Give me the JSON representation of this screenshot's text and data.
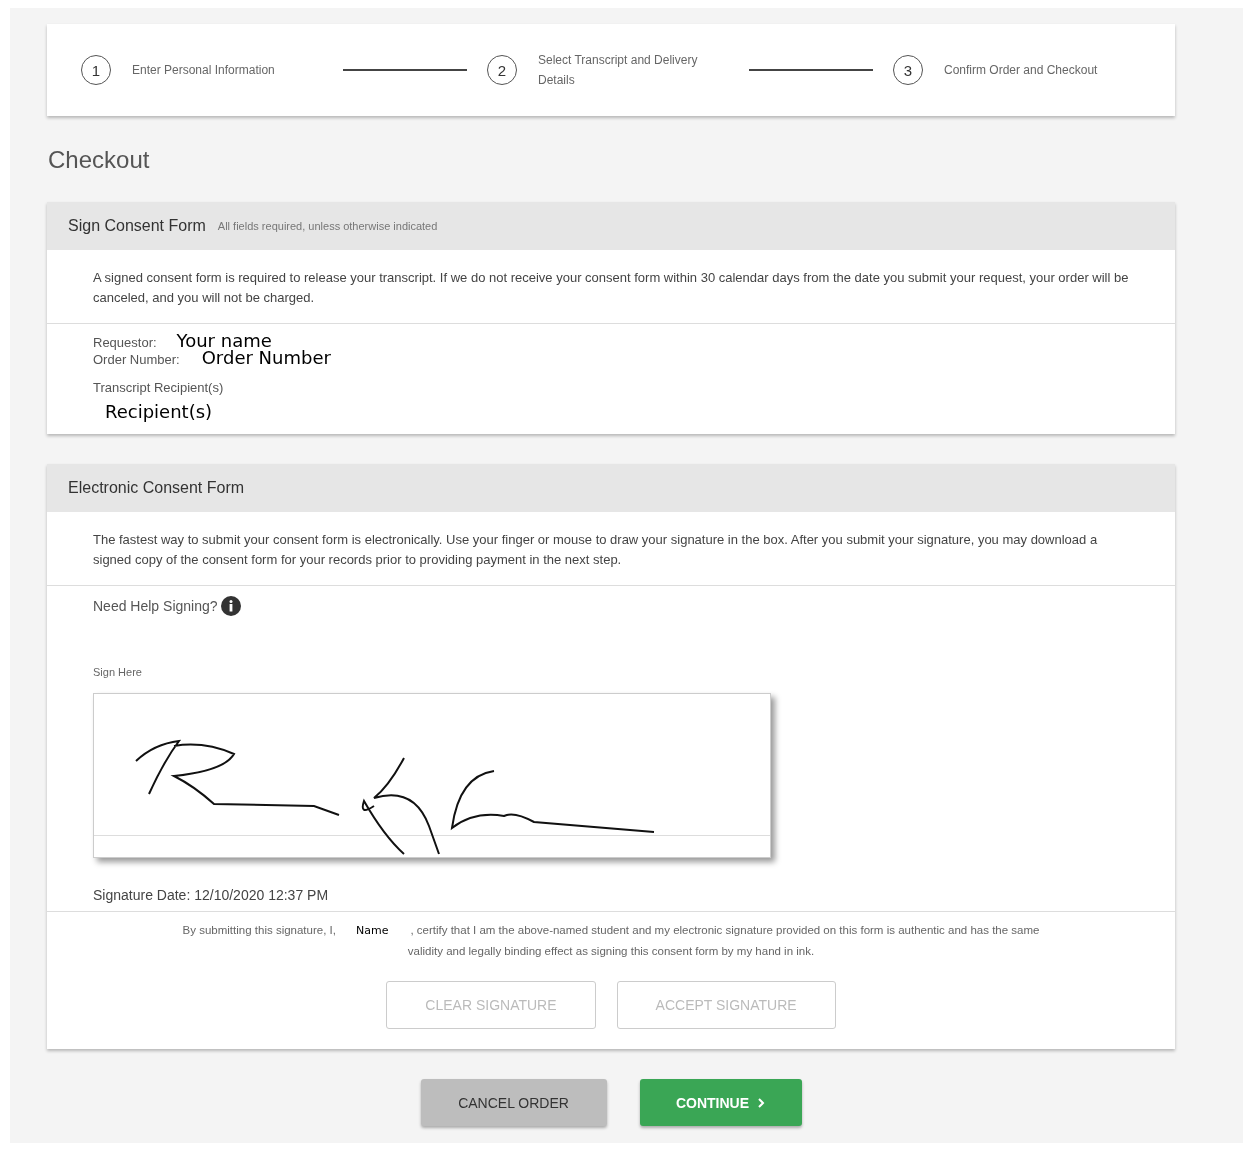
{
  "steps": [
    {
      "number": "1",
      "label": "Enter Personal Information"
    },
    {
      "number": "2",
      "label": "Select Transcript and Delivery Details"
    },
    {
      "number": "3",
      "label": "Confirm Order and Checkout"
    }
  ],
  "page_title": "Checkout",
  "consent_section": {
    "title": "Sign Consent Form",
    "note": "All fields required, unless otherwise indicated",
    "intro": "A signed consent form is required to release your transcript. If we do not receive your consent form within 30 calendar days from the date you submit your request, your order will be canceled, and you will not be charged.",
    "requestor_label": "Requestor:",
    "requestor_value": "Your name",
    "order_label": "Order Number:",
    "order_value": "Order Number",
    "recipients_label": "Transcript Recipient(s)",
    "recipients_value": "Recipient(s)"
  },
  "electronic_section": {
    "title": "Electronic Consent Form",
    "intro": "The fastest way to submit your consent form is electronically. Use your finger or mouse to draw your signature in the box. After you submit your signature, you may download a signed copy of the consent form for your records prior to providing payment in the next step.",
    "help_label": "Need Help Signing?",
    "sign_label": "Sign Here",
    "signature_date": "Signature Date: 12/10/2020 12:37 PM",
    "certify_before": "By submitting this signature, I,",
    "certify_name": "Name",
    "certify_after": ", certify that I am the above-named student and my electronic signature provided on this form is authentic and has the same validity and legally binding effect as signing this consent form by my hand in ink.",
    "buttons": [
      {
        "label": "CLEAR SIGNATURE",
        "disabled": true
      },
      {
        "label": "ACCEPT SIGNATURE",
        "disabled": true
      }
    ]
  },
  "actions": [
    {
      "label": "CANCEL ORDER",
      "kind": "secondary"
    },
    {
      "label": "CONTINUE",
      "kind": "primary"
    }
  ]
}
